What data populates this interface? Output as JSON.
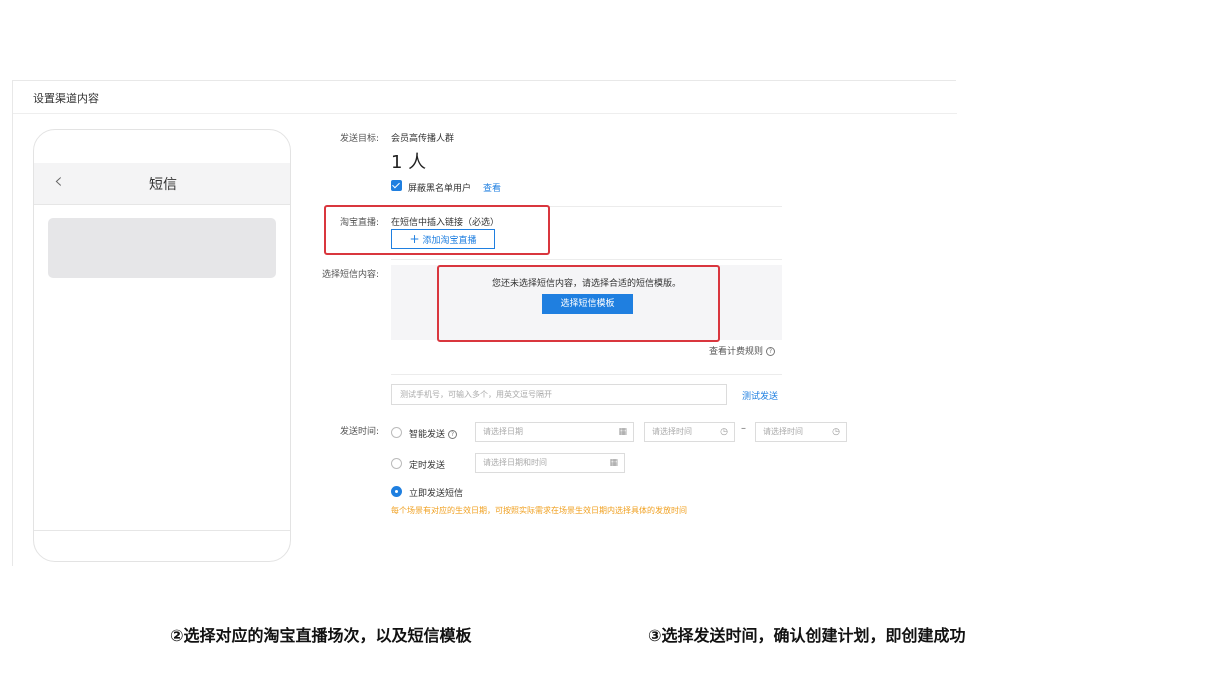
{
  "panel": {
    "title": "设置渠道内容"
  },
  "phone": {
    "back_icon": "‹",
    "title": "短信"
  },
  "form": {
    "target_label": "发送目标:",
    "target_value": "会员高传播人群",
    "target_count": "1 人",
    "blacklist_label": "屏蔽黑名单用户",
    "blacklist_link": "查看",
    "taobao_label": "淘宝直播:",
    "taobao_hint": "在短信中插入链接（必选）",
    "add_taobao_button": "添加淘宝直播",
    "sms_label": "选择短信内容:",
    "sms_hint": "您还未选择短信内容，请选择合适的短信模版。",
    "sms_button": "选择短信模板",
    "rule_link": "查看计费规则",
    "phone_placeholder": "测试手机号，可输入多个，用英文逗号隔开",
    "test_send": "测试发送",
    "time_label": "发送时间:",
    "smart_send": "智能发送",
    "date_placeholder": "请选择日期",
    "time_placeholder_1": "请选择时间",
    "time_placeholder_2": "请选择时间",
    "range_dash": "–",
    "scheduled_send": "定时发送",
    "datetime_placeholder": "请选择日期和时间",
    "immediate_send": "立即发送短信",
    "warning": "每个场景有对应的生效日期，可按照实际需求在场景生效日期内选择具体的发放时间"
  },
  "captions": {
    "step2": "②选择对应的淘宝直播场次，以及短信模板",
    "step3": "③选择发送时间，确认创建计划，即创建成功"
  },
  "colors": {
    "primary": "#1f7fe0",
    "highlight": "#d9363e",
    "warning": "#f0a020"
  }
}
